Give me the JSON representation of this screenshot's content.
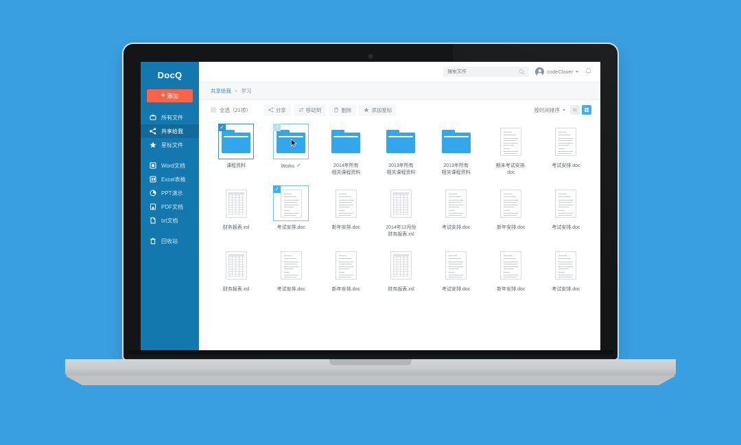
{
  "background_color": "#3a9fe0",
  "app": {
    "brand": "DocQ",
    "accent_blue": "#1378ae",
    "accent_orange": "#f76449",
    "folder_blue": "#33a7ec"
  },
  "sidebar": {
    "add_button": {
      "label": "添加",
      "icon": "plus-icon"
    },
    "items": [
      {
        "label": "所有文件",
        "icon": "all-files-icon",
        "active": false
      },
      {
        "label": "共享给我",
        "icon": "share-icon",
        "active": true
      },
      {
        "label": "星标文件",
        "icon": "star-icon",
        "active": false
      },
      {
        "label": "Word文档",
        "icon": "word-icon",
        "active": false
      },
      {
        "label": "Excel表格",
        "icon": "excel-icon",
        "active": false
      },
      {
        "label": "PPT演示",
        "icon": "ppt-icon",
        "active": false
      },
      {
        "label": "PDF文档",
        "icon": "pdf-icon",
        "active": false
      },
      {
        "label": "txt文档",
        "icon": "txt-icon",
        "active": false
      },
      {
        "label": "回收站",
        "icon": "trash-icon",
        "active": false
      }
    ]
  },
  "topbar": {
    "search": {
      "placeholder": "搜索文件",
      "value": "",
      "icon": "search-icon"
    },
    "user": {
      "name": "codeClover",
      "avatar": "avatar-icon",
      "caret": "chevron-down-icon"
    },
    "notification": {
      "icon": "bell-icon"
    }
  },
  "breadcrumb": {
    "parent": "共享给我",
    "separator": ">",
    "current": "学习"
  },
  "toolbar": {
    "select_all": {
      "label": "全选（21项）",
      "checked": false
    },
    "actions": [
      {
        "label": "分享",
        "icon": "share-icon"
      },
      {
        "label": "移动到",
        "icon": "move-icon"
      },
      {
        "label": "删除",
        "icon": "trash-icon"
      },
      {
        "label": "添加星标",
        "icon": "star-icon"
      }
    ],
    "sort": {
      "label": "按时间排序",
      "icon": "chevron-down-icon"
    },
    "view": {
      "list": {
        "icon": "list-view-icon",
        "active": false
      },
      "grid": {
        "icon": "grid-view-icon",
        "active": true
      }
    }
  },
  "files": [
    {
      "name": "课程资料",
      "type": "folder",
      "state": "selected"
    },
    {
      "name": "Works",
      "type": "folder",
      "state": "hover",
      "rename_icon": "pencil-icon"
    },
    {
      "name": "2014年所有\n相关课程资料",
      "type": "folder",
      "state": "normal"
    },
    {
      "name": "2013年所有\n相关课程资料",
      "type": "folder",
      "state": "normal"
    },
    {
      "name": "2013年所有\n相关课程资料",
      "type": "folder",
      "state": "normal"
    },
    {
      "name": "期末考试安排.\ndoc",
      "type": "doc",
      "state": "normal"
    },
    {
      "name": "考试安排.doc",
      "type": "doc",
      "state": "normal"
    },
    {
      "name": "财务报表.xsl",
      "type": "sheet",
      "state": "normal"
    },
    {
      "name": "考试安排.doc",
      "type": "doc",
      "state": "selected"
    },
    {
      "name": "新年安排.doc",
      "type": "doc",
      "state": "normal"
    },
    {
      "name": "2014年12月份\n财务报表.xsl",
      "type": "sheet",
      "state": "normal"
    },
    {
      "name": "考试安排.doc",
      "type": "doc",
      "state": "normal"
    },
    {
      "name": "新年安排.doc",
      "type": "doc",
      "state": "normal"
    },
    {
      "name": "考试安排.doc",
      "type": "doc",
      "state": "normal"
    },
    {
      "name": "财务报表.xsl",
      "type": "sheet",
      "state": "normal"
    },
    {
      "name": "考试安排.doc",
      "type": "doc",
      "state": "normal"
    },
    {
      "name": "新年安排.doc",
      "type": "doc",
      "state": "normal"
    },
    {
      "name": "财务报表.xsl",
      "type": "sheet",
      "state": "normal"
    },
    {
      "name": "考试安排.doc",
      "type": "doc",
      "state": "normal"
    },
    {
      "name": "新年安排.doc",
      "type": "doc",
      "state": "normal"
    },
    {
      "name": "考试安排.doc",
      "type": "doc",
      "state": "normal"
    }
  ]
}
